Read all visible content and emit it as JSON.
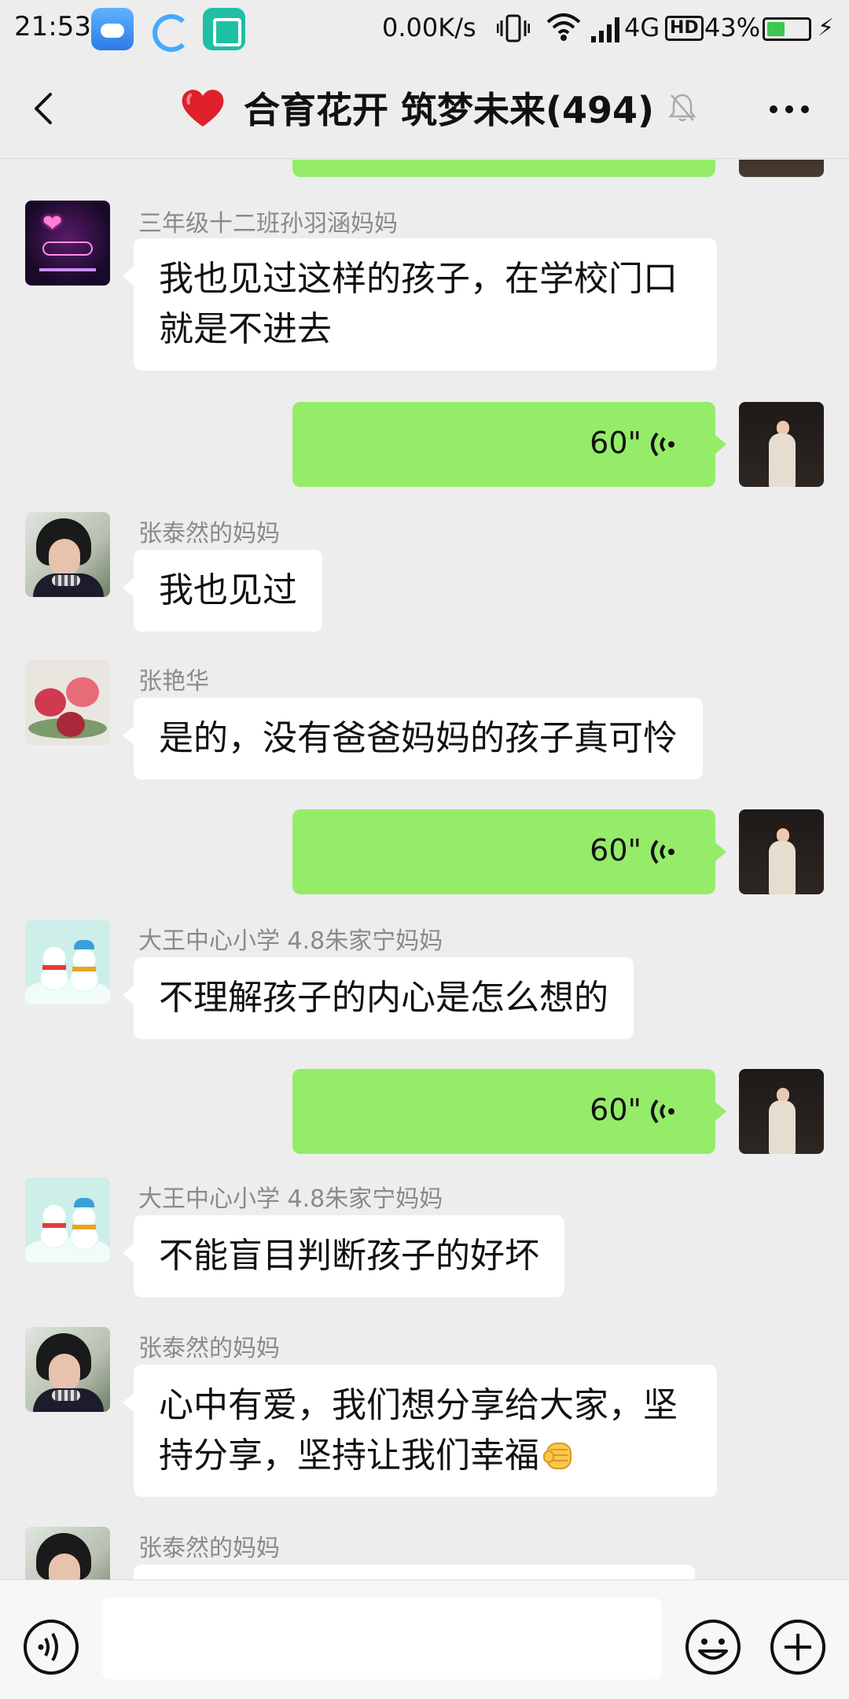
{
  "status_bar": {
    "time": "21:53",
    "net_speed": "0.00K/s",
    "network": "4G",
    "hd": "HD",
    "battery_percent": "43%",
    "battery_level": 0.43,
    "app_icons": [
      "weather-icon",
      "qq-browser-icon",
      "scan-icon"
    ]
  },
  "header": {
    "title": "合育花开 筑梦未来(494)",
    "title_emoji": "heart-icon",
    "muted": true
  },
  "messages": [
    {
      "type": "text",
      "side": "left",
      "sender": "三年级十二班孙羽涵妈妈",
      "avatar": "avatar-li",
      "lines": [
        "我也见过这样的孩子，在学校门口",
        "就是不进去"
      ]
    },
    {
      "type": "voice",
      "side": "right",
      "duration": "60\""
    },
    {
      "type": "text",
      "side": "left",
      "sender": "张泰然的妈妈",
      "avatar": "avatar-woman",
      "lines": [
        "我也见过"
      ]
    },
    {
      "type": "text",
      "side": "left",
      "sender": "张艳华",
      "avatar": "avatar-flower",
      "lines": [
        "是的，没有爸爸妈妈的孩子真可怜"
      ]
    },
    {
      "type": "voice",
      "side": "right",
      "duration": "60\""
    },
    {
      "type": "text",
      "side": "left",
      "sender": "大王中心小学 4.8朱家宁妈妈",
      "avatar": "avatar-snowman",
      "lines": [
        "不理解孩子的内心是怎么想的"
      ]
    },
    {
      "type": "voice",
      "side": "right",
      "duration": "60\""
    },
    {
      "type": "text",
      "side": "left",
      "sender": "大王中心小学 4.8朱家宁妈妈",
      "avatar": "avatar-snowman",
      "lines": [
        "不能盲目判断孩子的好坏"
      ]
    },
    {
      "type": "text",
      "side": "left",
      "sender": "张泰然的妈妈",
      "avatar": "avatar-woman",
      "lines": [
        "心中有爱，我们想分享给大家，坚",
        "持分享，坚持让我们幸福"
      ],
      "trailing_emoji": "fist-emoji-icon"
    },
    {
      "type": "text",
      "side": "left",
      "sender": "张泰然的妈妈",
      "avatar": "avatar-woman",
      "lines": []
    }
  ],
  "input": {
    "value": "",
    "placeholder": ""
  },
  "colors": {
    "background": "#ededed",
    "own_bubble": "#95ec69",
    "other_bubble": "#ffffff",
    "sender_text": "#8a8a8a"
  }
}
